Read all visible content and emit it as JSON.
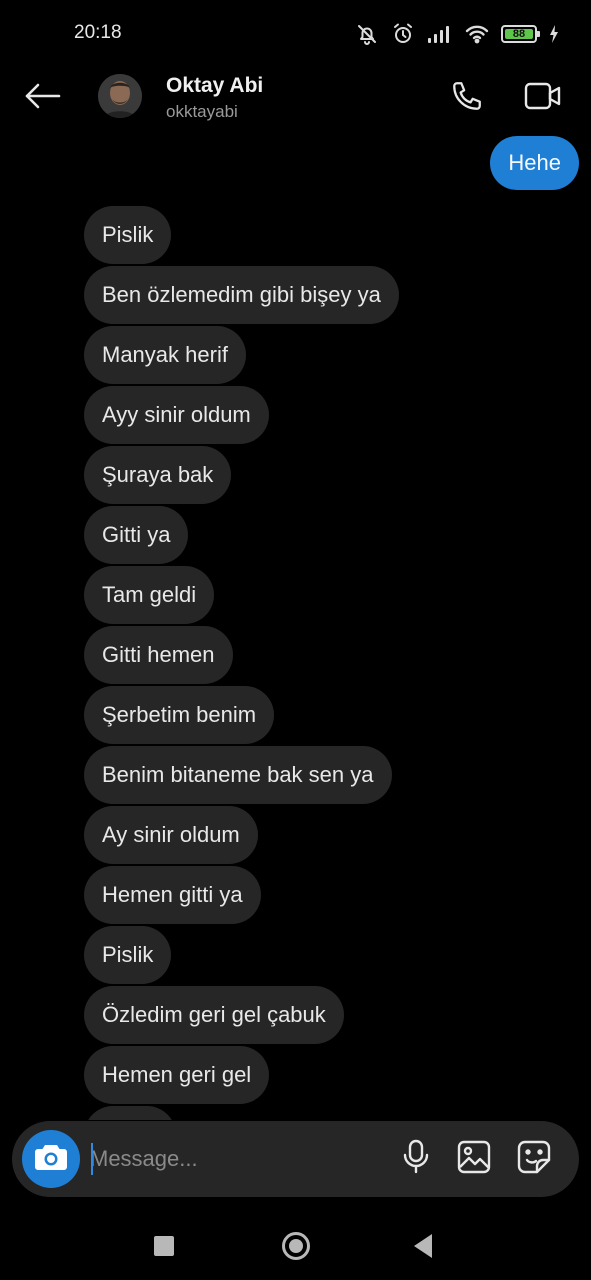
{
  "status_bar": {
    "time": "20:18",
    "battery": "88",
    "battery_level": 0.88,
    "icons": [
      "bell-muted-icon",
      "alarm-icon",
      "signal-icon",
      "wifi-icon",
      "battery-icon",
      "charging-icon"
    ]
  },
  "header": {
    "contact_name": "Oktay Abi",
    "contact_username": "okktayabi",
    "icons": [
      "back-arrow-icon",
      "phone-icon",
      "video-camera-icon"
    ]
  },
  "messages": {
    "outgoing": [
      "Hehe"
    ],
    "incoming": [
      "Pislik",
      "Ben özlemedim gibi bişey ya",
      "Manyak herif",
      "Ayy sinir oldum",
      "Şuraya bak",
      "Gitti ya",
      "Tam geldi",
      "Gitti hemen",
      "Şerbetim benim",
      "Benim bitaneme bak sen ya",
      "Ay sinir oldum",
      "Hemen gitti ya",
      "Pislik",
      "Özledim geri gel çabuk",
      "Hemen geri gel"
    ]
  },
  "composer": {
    "placeholder": "Message...",
    "icons": [
      "camera-icon",
      "microphone-icon",
      "gallery-icon",
      "sticker-icon"
    ]
  },
  "nav_bar": {
    "icons": [
      "recents-icon",
      "home-icon",
      "back-icon"
    ]
  },
  "colors": {
    "background": "#000000",
    "outgoing_bubble": "#1f7fd4",
    "incoming_bubble": "#262626",
    "composer": "#262626",
    "accent": "#1f7fd4"
  }
}
